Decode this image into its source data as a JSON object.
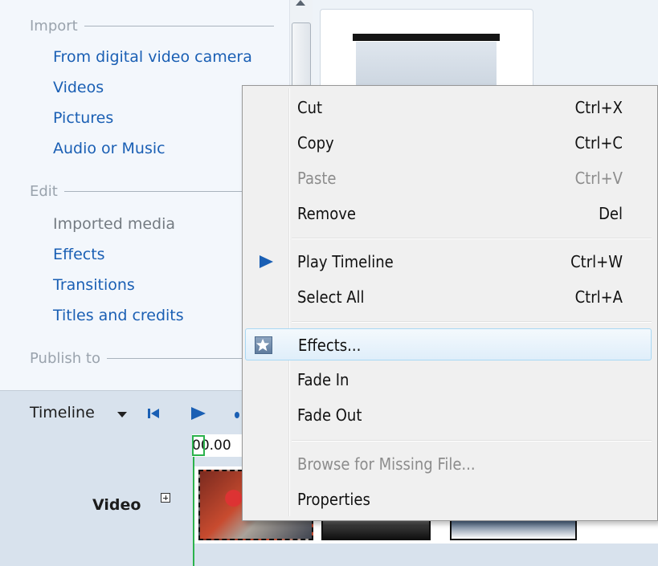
{
  "tasks_pane": {
    "import": {
      "header": "Import",
      "links": [
        "From digital video camera",
        "Videos",
        "Pictures",
        "Audio or Music"
      ]
    },
    "edit": {
      "header": "Edit",
      "links": [
        "Imported media",
        "Effects",
        "Transitions",
        "Titles and credits"
      ]
    },
    "publish": {
      "header": "Publish to"
    }
  },
  "timeline": {
    "label": "Timeline",
    "time_readout": "00.00",
    "video_track_label": "Video"
  },
  "context_menu": {
    "items": [
      {
        "label": "Cut",
        "shortcut": "Ctrl+X",
        "enabled": true
      },
      {
        "label": "Copy",
        "shortcut": "Ctrl+C",
        "enabled": true
      },
      {
        "label": "Paste",
        "shortcut": "Ctrl+V",
        "enabled": false
      },
      {
        "label": "Remove",
        "shortcut": "Del",
        "enabled": true
      },
      {
        "label": "Play Timeline",
        "shortcut": "Ctrl+W",
        "enabled": true,
        "icon": "play-icon"
      },
      {
        "label": "Select All",
        "shortcut": "Ctrl+A",
        "enabled": true
      },
      {
        "label": "Effects...",
        "shortcut": "",
        "enabled": true,
        "icon": "star-icon",
        "highlighted": true
      },
      {
        "label": "Fade In",
        "shortcut": "",
        "enabled": true
      },
      {
        "label": "Fade Out",
        "shortcut": "",
        "enabled": true
      },
      {
        "label": "Browse for Missing File...",
        "shortcut": "",
        "enabled": false
      },
      {
        "label": "Properties",
        "shortcut": "",
        "enabled": true
      }
    ]
  },
  "colors": {
    "link": "#1a5fb4",
    "menu_highlight_border": "#a8d8f4",
    "playhead": "#2bb24c"
  }
}
